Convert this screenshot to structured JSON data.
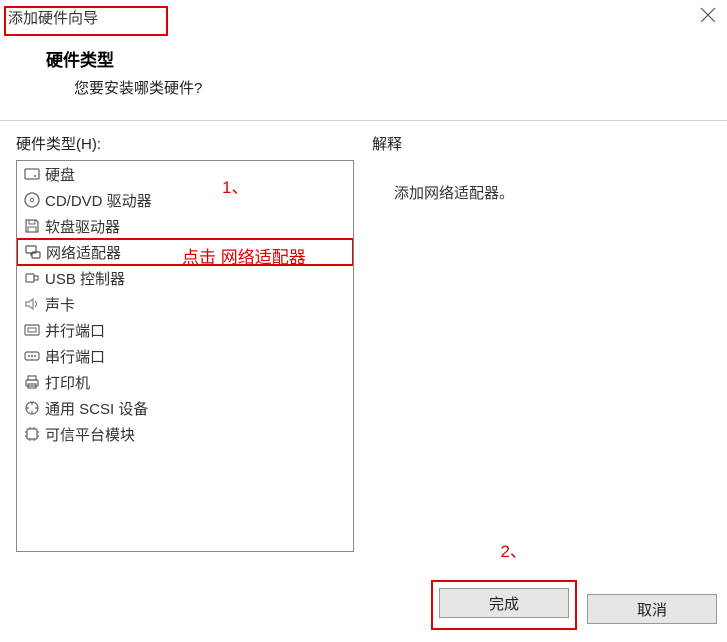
{
  "window": {
    "title": "添加硬件向导"
  },
  "header": {
    "title": "硬件类型",
    "subtitle": "您要安装哪类硬件?"
  },
  "left": {
    "label": "硬件类型(H):",
    "items": [
      {
        "icon": "hdd-icon",
        "label": "硬盘"
      },
      {
        "icon": "disc-icon",
        "label": "CD/DVD 驱动器"
      },
      {
        "icon": "floppy-icon",
        "label": "软盘驱动器"
      },
      {
        "icon": "network-icon",
        "label": "网络适配器"
      },
      {
        "icon": "usb-icon",
        "label": "USB 控制器"
      },
      {
        "icon": "sound-icon",
        "label": "声卡"
      },
      {
        "icon": "parallel-icon",
        "label": "并行端口"
      },
      {
        "icon": "serial-icon",
        "label": "串行端口"
      },
      {
        "icon": "printer-icon",
        "label": "打印机"
      },
      {
        "icon": "scsi-icon",
        "label": "通用 SCSI 设备"
      },
      {
        "icon": "tpm-icon",
        "label": "可信平台模块"
      }
    ],
    "selected_index": 3
  },
  "right": {
    "label": "解释",
    "description": "添加网络适配器。"
  },
  "footer": {
    "finish": "完成",
    "cancel": "取消"
  },
  "annotations": {
    "a1": "1、",
    "a2": "点击   网络适配器",
    "a3": "2、"
  }
}
